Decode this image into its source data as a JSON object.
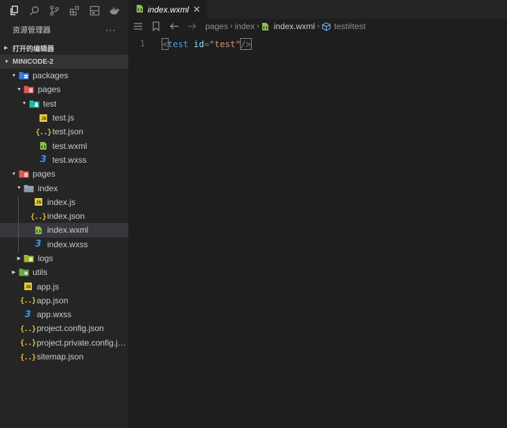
{
  "activity_bar": {
    "icons": [
      "files-icon",
      "search-icon",
      "source-control-icon",
      "extensions-icon",
      "layout-icon",
      "docker-icon"
    ]
  },
  "explorer": {
    "title": "资源管理器",
    "more": "···",
    "open_editors_label": "打开的编辑器",
    "project_label": "MINICODE-2"
  },
  "tree": [
    {
      "label": "packages",
      "type": "folder-packages",
      "depth": 1,
      "expanded": true
    },
    {
      "label": "pages",
      "type": "folder-pages",
      "depth": 2,
      "expanded": true
    },
    {
      "label": "test",
      "type": "folder-test",
      "depth": 3,
      "expanded": true
    },
    {
      "label": "test.js",
      "type": "js",
      "depth": 4
    },
    {
      "label": "test.json",
      "type": "json",
      "depth": 4
    },
    {
      "label": "test.wxml",
      "type": "wxml",
      "depth": 4
    },
    {
      "label": "test.wxss",
      "type": "wxss",
      "depth": 4
    },
    {
      "label": "pages",
      "type": "folder-pages",
      "depth": 1,
      "expanded": true
    },
    {
      "label": "index",
      "type": "folder-plain",
      "depth": 2,
      "expanded": true
    },
    {
      "label": "index.js",
      "type": "js",
      "depth": 3
    },
    {
      "label": "index.json",
      "type": "json",
      "depth": 3
    },
    {
      "label": "index.wxml",
      "type": "wxml",
      "depth": 3,
      "selected": true
    },
    {
      "label": "index.wxss",
      "type": "wxss",
      "depth": 3
    },
    {
      "label": "logs",
      "type": "folder-logs",
      "depth": 2,
      "expanded": false
    },
    {
      "label": "utils",
      "type": "folder-utils",
      "depth": 1,
      "expanded": false
    },
    {
      "label": "app.js",
      "type": "js",
      "depth": 1
    },
    {
      "label": "app.json",
      "type": "json",
      "depth": 1
    },
    {
      "label": "app.wxss",
      "type": "wxss",
      "depth": 1
    },
    {
      "label": "project.config.json",
      "type": "json",
      "depth": 1
    },
    {
      "label": "project.private.config.js...",
      "type": "json",
      "depth": 1
    },
    {
      "label": "sitemap.json",
      "type": "json",
      "depth": 1
    }
  ],
  "editor": {
    "tab_label": "index.wxml",
    "tab_close": "✕",
    "breadcrumb": [
      "pages",
      "index",
      "index.wxml",
      "test#test"
    ],
    "line_number": "1",
    "code": {
      "open": "<",
      "tag": "test",
      "space": " ",
      "attr": "id",
      "eq": "=",
      "value": "\"test\"",
      "close": "/>"
    }
  },
  "colors": {
    "sidebar_bg": "#252526",
    "editor_bg": "#1e1e1e",
    "selected_row": "#37373d",
    "wxml_icon": "#8dc149",
    "js_icon": "#e8c93b",
    "wxss_icon": "#3e94e0"
  }
}
